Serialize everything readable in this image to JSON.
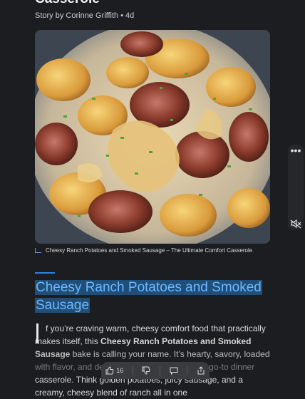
{
  "article": {
    "title_partial": "Casserole",
    "byline": {
      "author": "Story by Corinne Griffith",
      "separator": "•",
      "age": "4d"
    },
    "image_caption": "Cheesy Ranch Potatoes and Smoked Sausage – The Ultimate Comfort Casserole",
    "headline": "Cheesy Ranch Potatoes and Smoked Sausage",
    "body": {
      "p1_start": "f you’re craving warm, cheesy comfort food that practically makes itself, this ",
      "p1_bold": "Cheesy Ranch Potatoes and Smoked Sausage",
      "p1_mid": " bake is calling your name. It’s hearty, savory, loaded with flavor, and destined to become your next go-to dinner casserole. Think golden potatoes, juicy sausage, and a creamy, cheesy blend of ranch all in one"
    }
  },
  "bottom_bar": {
    "like_count": "16"
  },
  "icons": {
    "more": "more-options-icon",
    "mute": "mute-icon",
    "like": "thumbs-up-icon",
    "dislike": "thumbs-down-icon",
    "comment": "comment-icon",
    "share": "share-icon"
  },
  "colors": {
    "background": "#1c1d20",
    "accent": "#2f7fe0",
    "headline_highlight": "#1f4f78",
    "headline_text": "#6fb8ff"
  }
}
